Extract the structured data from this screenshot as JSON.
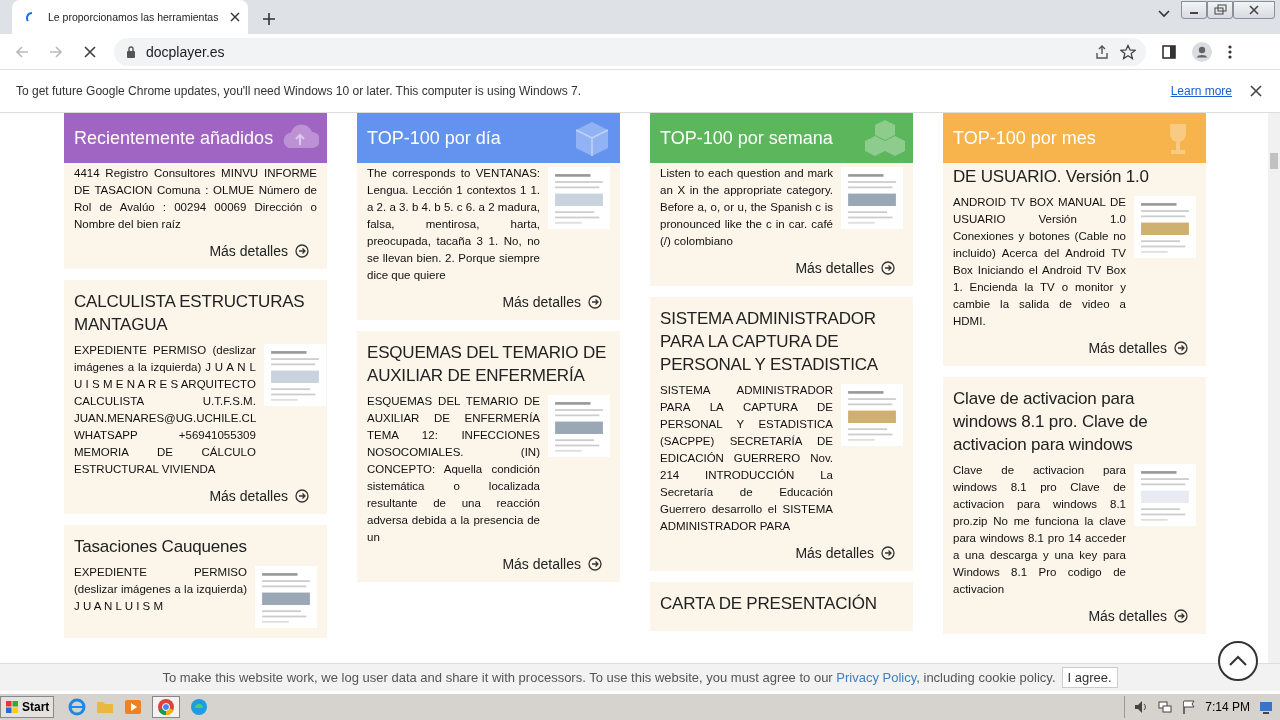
{
  "tab": {
    "title": "Le proporcionamos las herramientas"
  },
  "address_bar": {
    "url": "docplayer.es"
  },
  "info_bar": {
    "message": "To get future Google Chrome updates, you'll need Windows 10 or later. This computer is using Windows 7.",
    "link": "Learn more"
  },
  "columns": [
    {
      "heading": "Recientemente añadidos",
      "color": "#a064c2",
      "cards": [
        {
          "text": "4414 Registro Consultores MINVU INFORME DE TASACION Comuna : OLMUE Número de Rol de Avalúo : 00294 00069 Dirección o Nombre del bien raíz",
          "link": "Más detalles"
        },
        {
          "title": "CALCULISTA ESTRUCTURAS MANTAGUA",
          "text": "EXPEDIENTE PERMISO (deslizar imágenes a la izquierda) J U A N L U I S M E N A R E S ARQUITECTO CALCULISTA U.T.F.S.M. JUAN.MENARES@UG.UCHILE.CL WHATSAPP +56941055309 MEMORIA DE CÁLCULO ESTRUCTURAL VIVIENDA",
          "link": "Más detalles"
        },
        {
          "title": "Tasaciones Cauquenes",
          "text": "EXPEDIENTE PERMISO (deslizar imágenes a la izquierda) J U A N L U I S M"
        }
      ]
    },
    {
      "heading": "TOP-100 por día",
      "color": "#6393ee",
      "cards": [
        {
          "text": "The corresponds to VENTANAS: Lengua. Lección 1 contextos 1 1. a 2. a 3. b 4. b 5. c 6. a 2 madura, falsa, mentirosa, harta, preocupada, tacaña 3 1. No, no se llevan bien. 2. Porque siempre dice que quiere",
          "link": "Más detalles"
        },
        {
          "title": "ESQUEMAS DEL TEMARIO DE AUXILIAR DE ENFERMERÍA",
          "text": "ESQUEMAS DEL TEMARIO DE AUXILIAR DE ENFERMERÍA TEMA 12: INFECCIONES NOSOCOMIALES. (IN) CONCEPTO: Aquella condición sistemática o localizada resultante de una reacción adversa debida a la presencia de un",
          "link": "Más detalles"
        }
      ]
    },
    {
      "heading": "TOP-100 por semana",
      "color": "#5cb65c",
      "cards": [
        {
          "text": "Listen to each question and mark an X in the appropriate category. Before a, o, or u, the Spanish c is pronounced like the c in car. café (/) colombiano",
          "link": "Más detalles"
        },
        {
          "title": "SISTEMA ADMINISTRADOR PARA LA CAPTURA DE PERSONAL Y ESTADISTICA",
          "text": "SISTEMA ADMINISTRADOR PARA LA CAPTURA DE PERSONAL Y ESTADISTICA (SACPPE) SECRETARÍA DE EDICACIÓN GUERRERO Nov. 214 INTRODUCCIÓN La Secretaría de Educación Guerrero desarrollo el SISTEMA ADMINISTRADOR PARA",
          "link": "Más detalles"
        },
        {
          "title": "CARTA DE PRESENTACIÓN"
        }
      ]
    },
    {
      "heading": "TOP-100 por mes",
      "color": "#f7b44c",
      "cards": [
        {
          "title": "DE USUARIO. Versión 1.0",
          "text": "ANDROID TV BOX MANUAL DE USUARIO Versión 1.0 Conexiones y botones (Cable no incluido) Acerca del Android TV Box Iniciando el Android TV Box 1. Encienda la TV o monitor y cambie la salida de video a HDMI.",
          "link": "Más detalles"
        },
        {
          "title": "Clave de activacion para windows 8.1 pro. Clave de activacion para windows",
          "text": "Clave de activacion para windows 8.1 pro Clave de activacion para windows 8.1 pro.zip No me funciona la clave para windows 8.1 pro 14 acceder a una descarga y una key para Windows 8.1 Pro codigo de activacion",
          "link": "Más detalles"
        }
      ]
    }
  ],
  "cookie_banner": {
    "text": "To make this website work, we log user data and share it with processors. To use this website, you must agree to our ",
    "link": "Privacy Policy",
    "text_after": ", including cookie policy.",
    "button": "I agree."
  },
  "taskbar": {
    "start": "Start",
    "clock": "7:14 PM"
  }
}
